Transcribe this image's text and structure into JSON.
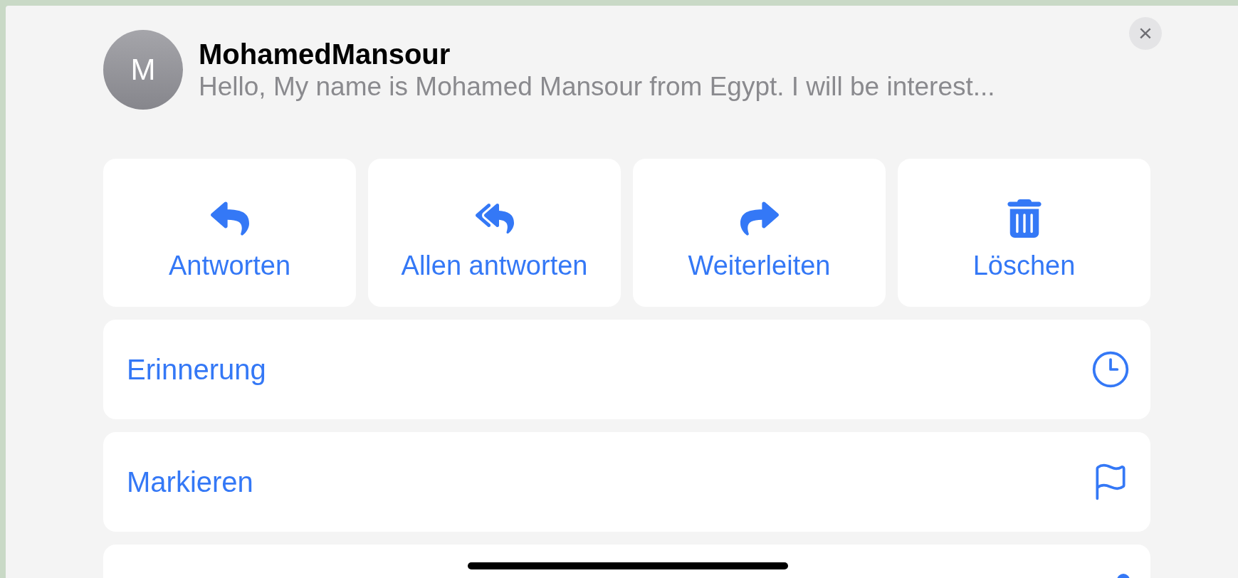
{
  "header": {
    "avatar_initial": "M",
    "sender": "MohamedMansour",
    "preview": "Hello, My name is Mohamed Mansour from Egypt. I will be interest..."
  },
  "close_button": "×",
  "actions": [
    {
      "label": "Antworten",
      "kind": "reply"
    },
    {
      "label": "Allen antworten",
      "kind": "reply-all"
    },
    {
      "label": "Weiterleiten",
      "kind": "forward"
    },
    {
      "label": "Löschen",
      "kind": "delete"
    }
  ],
  "menu_rows": [
    {
      "label": "Erinnerung",
      "kind": "reminder"
    },
    {
      "label": "Markieren",
      "kind": "flag"
    },
    {
      "kind": "partial"
    }
  ]
}
